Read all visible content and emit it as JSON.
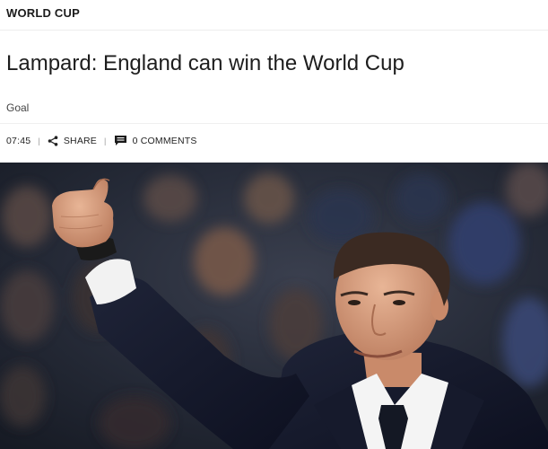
{
  "article": {
    "category": "WORLD CUP",
    "headline": "Lampard: England can win the World Cup",
    "source": "Goal",
    "meta": {
      "time": "07:45",
      "share_label": "SHARE",
      "comments_label": "0 COMMENTS"
    },
    "image": {
      "icon": "photo-thumbs-up-man-in-suit"
    }
  }
}
